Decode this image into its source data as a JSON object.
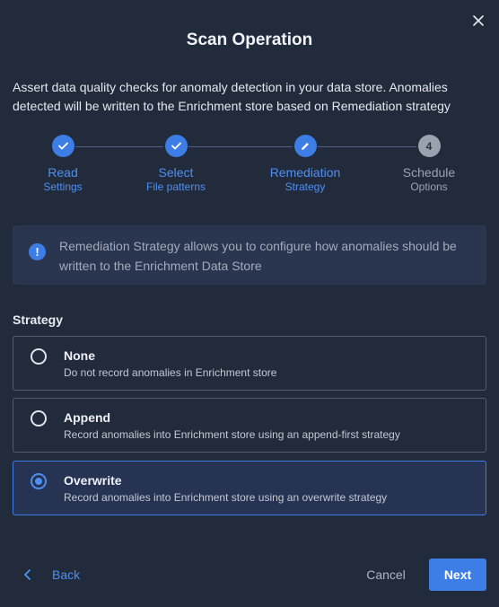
{
  "dialog": {
    "title": "Scan Operation",
    "description": "Assert data quality checks for anomaly detection in your data store. Anomalies detected will be written to the Enrichment store based on Remediation strategy"
  },
  "stepper": {
    "steps": [
      {
        "label": "Read",
        "sublabel": "Settings",
        "status": "completed",
        "icon": "check-icon"
      },
      {
        "label": "Select",
        "sublabel": "File patterns",
        "status": "completed",
        "icon": "check-icon"
      },
      {
        "label": "Remediation",
        "sublabel": "Strategy",
        "status": "active",
        "icon": "pencil-icon"
      },
      {
        "label": "Schedule",
        "sublabel": "Options",
        "status": "pending",
        "number": "4"
      }
    ]
  },
  "info": {
    "icon": "exclamation-icon",
    "text": "Remediation Strategy allows you to configure how anomalies should be written to the Enrichment Data Store"
  },
  "strategy": {
    "label": "Strategy",
    "selected": "Overwrite",
    "options": [
      {
        "title": "None",
        "description": "Do not record anomalies in Enrichment store"
      },
      {
        "title": "Append",
        "description": "Record anomalies into Enrichment store using an append-first strategy"
      },
      {
        "title": "Overwrite",
        "description": "Record anomalies into Enrichment store using an overwrite strategy"
      }
    ]
  },
  "footer": {
    "back_label": "Back",
    "cancel_label": "Cancel",
    "next_label": "Next"
  },
  "colors": {
    "background": "#222b3c",
    "accent": "#3d7ee6",
    "pending": "#9aa2af"
  }
}
